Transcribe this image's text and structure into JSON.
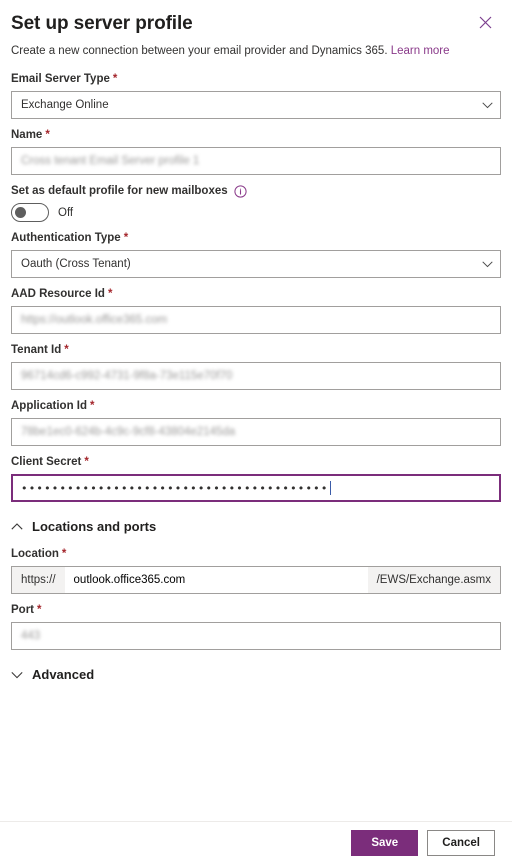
{
  "dialog": {
    "title": "Set up server profile",
    "subtitle_text": "Create a new connection between your email provider and Dynamics 365.",
    "learn_more": "Learn more",
    "close_label": "Close"
  },
  "fields": {
    "email_server_type": {
      "label": "Email Server Type",
      "required": "*",
      "value": "Exchange Online"
    },
    "name": {
      "label": "Name",
      "required": "*",
      "value": "Cross tenant Email Server profile 1"
    },
    "default_profile": {
      "label": "Set as default profile for new mailboxes",
      "toggle_state": "Off"
    },
    "authentication_type": {
      "label": "Authentication Type",
      "required": "*",
      "value": "Oauth (Cross Tenant)"
    },
    "aad_resource_id": {
      "label": "AAD Resource Id",
      "required": "*",
      "value": "https://outlook.office365.com"
    },
    "tenant_id": {
      "label": "Tenant Id",
      "required": "*",
      "value": "96714cd6-c992-4731-9f8a-73e115e70f70"
    },
    "application_id": {
      "label": "Application Id",
      "required": "*",
      "value": "78be1ec0-624b-4c9c-9cf8-43804e2145da"
    },
    "client_secret": {
      "label": "Client Secret",
      "required": "*",
      "value": "••••••••••••••••••••••••••••••••••••••••"
    },
    "location": {
      "label": "Location",
      "required": "*",
      "prefix": "https://",
      "value": "outlook.office365.com",
      "suffix": "/EWS/Exchange.asmx"
    },
    "port": {
      "label": "Port",
      "required": "*",
      "value": "443"
    }
  },
  "sections": {
    "locations_and_ports": {
      "label": "Locations and ports",
      "state": "expanded"
    },
    "advanced": {
      "label": "Advanced",
      "state": "collapsed"
    }
  },
  "footer": {
    "save_label": "Save",
    "cancel_label": "Cancel"
  },
  "colors": {
    "accent": "#7b2d7b",
    "link": "#8a3a8a",
    "required": "#a4262c",
    "border": "#a19f9d",
    "text": "#323130"
  }
}
